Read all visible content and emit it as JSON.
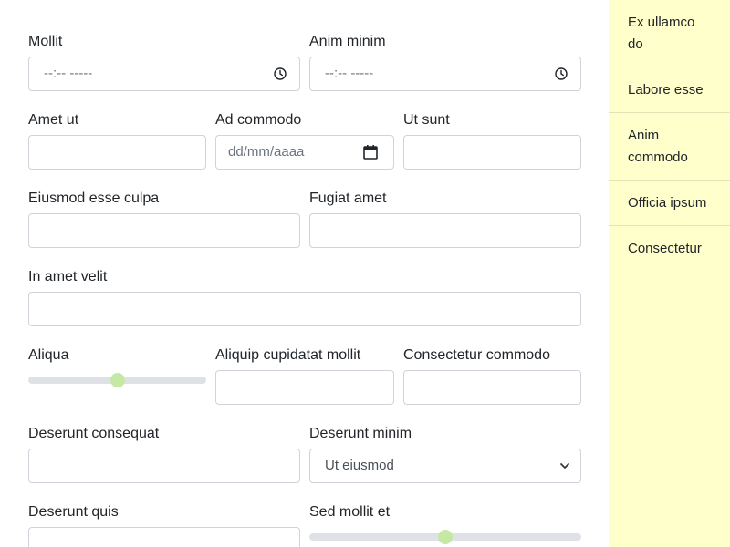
{
  "form": {
    "row1": {
      "mollit_label": "Mollit",
      "mollit_value": "--:-- -----",
      "anim_minim_label": "Anim minim",
      "anim_minim_value": "--:-- -----"
    },
    "row2": {
      "amet_ut_label": "Amet ut",
      "ad_commodo_label": "Ad commodo",
      "ad_commodo_value": "dd/mm/aaaa",
      "ut_sunt_label": "Ut sunt"
    },
    "row3": {
      "eiusmod_label": "Eiusmod esse culpa",
      "fugiat_label": "Fugiat amet"
    },
    "row4": {
      "in_amet_label": "In amet velit"
    },
    "row5": {
      "aliqua_label": "Aliqua",
      "aliqua_value": 0.5,
      "aliquip_label": "Aliquip cupidatat mollit",
      "consectetur_commodo_label": "Consectetur commodo"
    },
    "row6": {
      "deserunt_consequat_label": "Deserunt consequat",
      "deserunt_minim_label": "Deserunt minim",
      "deserunt_minim_selected": "Ut eiusmod"
    },
    "row7": {
      "deserunt_quis_label": "Deserunt quis",
      "sed_mollit_label": "Sed mollit et",
      "sed_mollit_value": 0.5
    }
  },
  "sidebar": {
    "items": [
      {
        "label": "Ex ullamco do"
      },
      {
        "label": "Labore esse"
      },
      {
        "label": "Anim commodo"
      },
      {
        "label": "Officia ipsum"
      },
      {
        "label": "Consectetur"
      }
    ]
  },
  "colors": {
    "sidebar_bg": "#ffffcc",
    "slider_thumb": "#c5e8a4",
    "slider_track": "#dee2e6",
    "input_border": "#ced4da"
  },
  "icons": {
    "time": "clock-icon",
    "date": "calendar-icon",
    "select": "chevron-down-icon"
  }
}
